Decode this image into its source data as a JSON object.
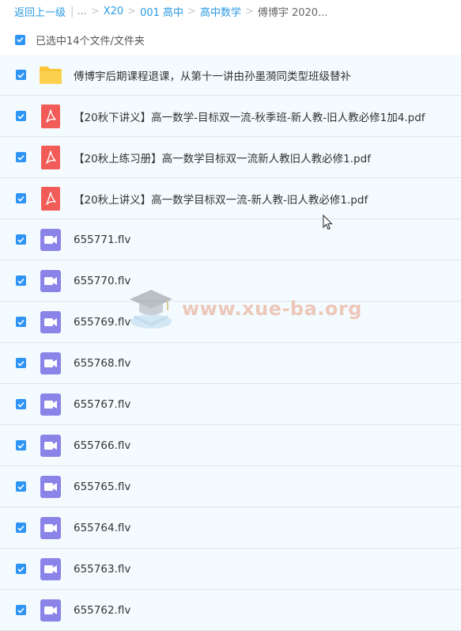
{
  "breadcrumb": {
    "back": "返回上一级",
    "ellipsis": "...",
    "items": [
      "X20",
      "001 高中",
      "高中数学"
    ],
    "current": "傅博宇 2020..."
  },
  "selection": {
    "label": "已选中14个文件/文件夹",
    "checked": true
  },
  "files": [
    {
      "type": "folder",
      "name": "傅博宇后期课程退课，从第十一讲由孙墨漪同类型班级替补",
      "checked": true
    },
    {
      "type": "pdf",
      "name": "【20秋下讲义】高一数学-目标双一流-秋季班-新人教-旧人教必修1加4.pdf",
      "checked": true
    },
    {
      "type": "pdf",
      "name": "【20秋上练习册】高一数学目标双一流新人教旧人教必修1.pdf",
      "checked": true
    },
    {
      "type": "pdf",
      "name": "【20秋上讲义】高一数学目标双一流-新人教-旧人教必修1.pdf",
      "checked": true
    },
    {
      "type": "video",
      "name": "655771.flv",
      "checked": true
    },
    {
      "type": "video",
      "name": "655770.flv",
      "checked": true
    },
    {
      "type": "video",
      "name": "655769.flv",
      "checked": true
    },
    {
      "type": "video",
      "name": "655768.flv",
      "checked": true
    },
    {
      "type": "video",
      "name": "655767.flv",
      "checked": true
    },
    {
      "type": "video",
      "name": "655766.flv",
      "checked": true
    },
    {
      "type": "video",
      "name": "655765.flv",
      "checked": true
    },
    {
      "type": "video",
      "name": "655764.flv",
      "checked": true
    },
    {
      "type": "video",
      "name": "655763.flv",
      "checked": true
    },
    {
      "type": "video",
      "name": "655762.flv",
      "checked": true
    }
  ],
  "watermark": {
    "text": "www.xue-ba.org"
  },
  "colors": {
    "link": "#2a9ae2",
    "checkbox": "#2e94f5",
    "folder": "#f9c437",
    "pdf": "#f25c58",
    "video": "#8a83e8",
    "row_bg": "#f4fbfe"
  }
}
